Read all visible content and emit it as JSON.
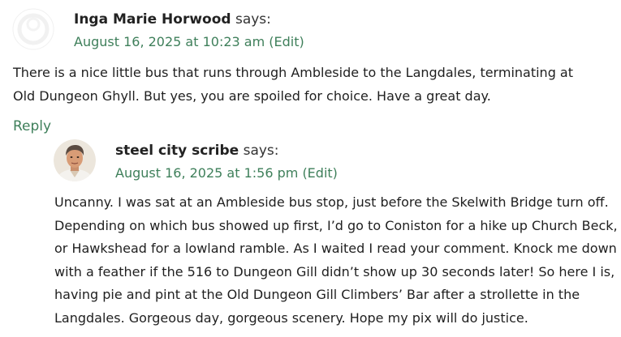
{
  "comments": [
    {
      "author": "Inga Marie Horwood",
      "says": "says:",
      "date": "August 16, 2025 at 10:23 am",
      "edit": "(Edit)",
      "body": "There is a nice little bus that runs through Ambleside to the Langdales, terminating at Old Dungeon Ghyll. But yes, you are spoiled for choice. Have a great day.",
      "reply": "Reply",
      "avatar_icon": "default-avatar-icon"
    },
    {
      "author": "steel city scribe",
      "says": "says:",
      "date": "August 16, 2025 at 1:56 pm",
      "edit": "(Edit)",
      "body": "Uncanny. I was sat at an Ambleside bus stop, just before the Skelwith Bridge turn off. Depending on which bus showed up first, I’d go to Coniston for a hike up Church Beck, or Hawkshead for a lowland ramble. As I waited I read your comment. Knock me down with a feather if the 516 to Dungeon Gill didn’t show up 30 seconds later! So here I is, having pie and pint at the Old Dungeon Gill Climbers’ Bar after a strollette in the Langdales. Gorgeous day, gorgeous scenery. Hope my pix will do justice.",
      "avatar_icon": "user-photo-avatar"
    }
  ],
  "colors": {
    "link": "#3e7f5a",
    "text": "#1f1f1f"
  }
}
